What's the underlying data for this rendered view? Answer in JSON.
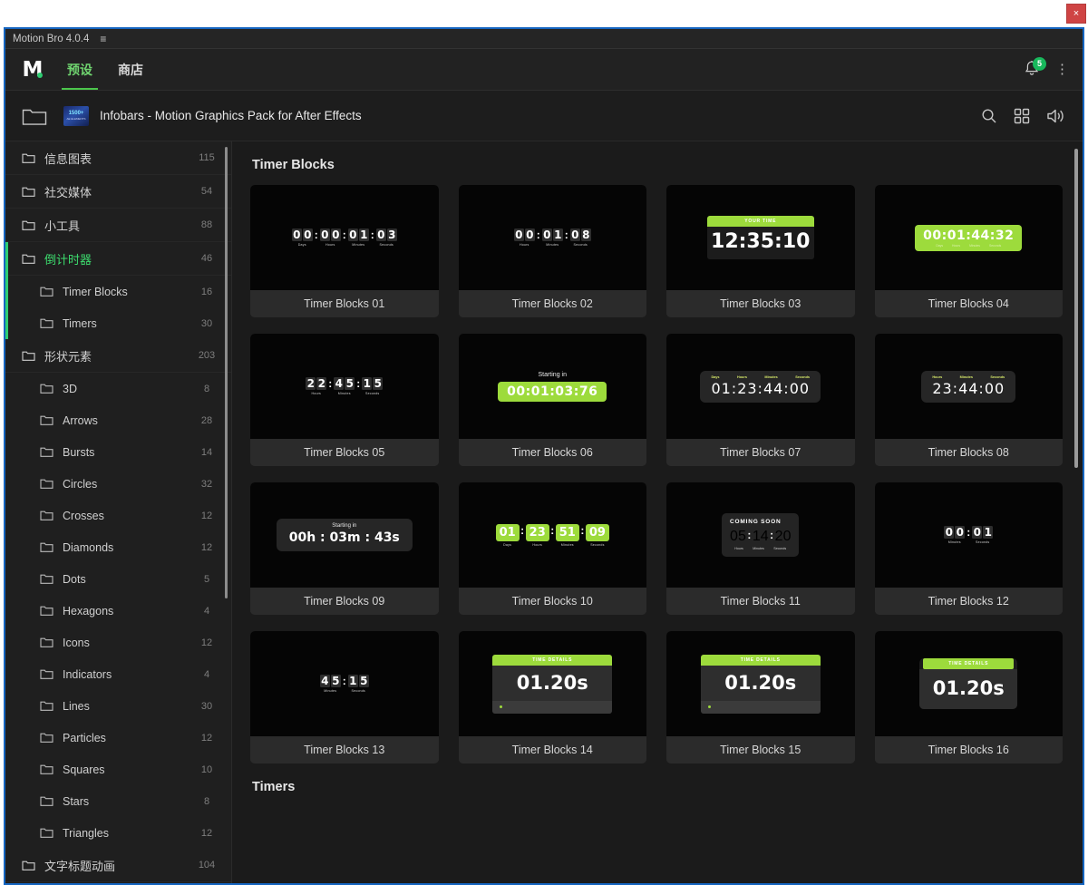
{
  "os": {
    "close_label": "×"
  },
  "panel": {
    "title": "Motion Bro 4.0.4",
    "menu_icon": "≡"
  },
  "nav": {
    "logo_letter": "M",
    "tabs": [
      {
        "label": "预设",
        "active": true
      },
      {
        "label": "商店",
        "active": false
      }
    ],
    "notification_count": "5",
    "kebab_label": "⋮"
  },
  "breadcrumb": {
    "pack_title": "Infobars - Motion Graphics Pack for After Effects",
    "thumb_text_main": "1500+",
    "thumb_text_sub": "AE ELEMENTS",
    "icons": [
      "search-icon",
      "grid-view-icon",
      "sound-icon"
    ]
  },
  "sidebar": {
    "items": [
      {
        "label": "信息图表",
        "count": "115",
        "child": false,
        "active": false
      },
      {
        "label": "社交媒体",
        "count": "54",
        "child": false,
        "active": false
      },
      {
        "label": "小工具",
        "count": "88",
        "child": false,
        "active": false
      },
      {
        "label": "倒计时器",
        "count": "46",
        "child": false,
        "active": true
      },
      {
        "label": "Timer Blocks",
        "count": "16",
        "child": true,
        "active": false
      },
      {
        "label": "Timers",
        "count": "30",
        "child": true,
        "active": false
      },
      {
        "label": "形状元素",
        "count": "203",
        "child": false,
        "active": false
      },
      {
        "label": "3D",
        "count": "8",
        "child": true,
        "active": false
      },
      {
        "label": "Arrows",
        "count": "28",
        "child": true,
        "active": false
      },
      {
        "label": "Bursts",
        "count": "14",
        "child": true,
        "active": false
      },
      {
        "label": "Circles",
        "count": "32",
        "child": true,
        "active": false
      },
      {
        "label": "Crosses",
        "count": "12",
        "child": true,
        "active": false
      },
      {
        "label": "Diamonds",
        "count": "12",
        "child": true,
        "active": false
      },
      {
        "label": "Dots",
        "count": "5",
        "child": true,
        "active": false
      },
      {
        "label": "Hexagons",
        "count": "4",
        "child": true,
        "active": false
      },
      {
        "label": "Icons",
        "count": "12",
        "child": true,
        "active": false
      },
      {
        "label": "Indicators",
        "count": "4",
        "child": true,
        "active": false
      },
      {
        "label": "Lines",
        "count": "30",
        "child": true,
        "active": false
      },
      {
        "label": "Particles",
        "count": "12",
        "child": true,
        "active": false
      },
      {
        "label": "Squares",
        "count": "10",
        "child": true,
        "active": false
      },
      {
        "label": "Stars",
        "count": "8",
        "child": true,
        "active": false
      },
      {
        "label": "Triangles",
        "count": "12",
        "child": true,
        "active": false
      },
      {
        "label": "文字标题动画",
        "count": "104",
        "child": false,
        "active": false
      }
    ]
  },
  "content": {
    "section_title": "Timer Blocks",
    "next_section_title": "Timers",
    "cards": [
      {
        "label": "Timer Blocks 01",
        "style": "flip4",
        "digits": [
          "00",
          "00",
          "01",
          "03"
        ],
        "caps": [
          "Days",
          "Hours",
          "Minutes",
          "Seconds"
        ]
      },
      {
        "label": "Timer Blocks 02",
        "style": "flip3",
        "digits": [
          "00",
          "01",
          "08"
        ],
        "caps": [
          "Hours",
          "Minutes",
          "Seconds"
        ]
      },
      {
        "label": "Timer Blocks 03",
        "style": "yourtime",
        "header": "YOUR TIME",
        "value": "12:35:10"
      },
      {
        "label": "Timer Blocks 04",
        "style": "greenpill",
        "value": "00:01:44:32",
        "caps": [
          "Days",
          "Hours",
          "Minutes",
          "Seconds"
        ]
      },
      {
        "label": "Timer Blocks 05",
        "style": "flip3",
        "digits": [
          "22",
          "45",
          "15"
        ],
        "caps": [
          "Hours",
          "Minutes",
          "Seconds"
        ]
      },
      {
        "label": "Timer Blocks 06",
        "style": "greenpill-titled",
        "header": "Starting in",
        "value": "00:01:03:76"
      },
      {
        "label": "Timer Blocks 07",
        "style": "darkpill",
        "value": "01:23:44:00",
        "caps": [
          "Days",
          "Hours",
          "Minutes",
          "Seconds"
        ]
      },
      {
        "label": "Timer Blocks 08",
        "style": "darkpill",
        "value": "23:44:00",
        "caps": [
          "Hours",
          "Minutes",
          "Seconds"
        ]
      },
      {
        "label": "Timer Blocks 09",
        "style": "darkpill-titled",
        "header": "Starting in",
        "value": "00h : 03m : 43s"
      },
      {
        "label": "Timer Blocks 10",
        "style": "greenblocks",
        "digits": [
          "01",
          "23",
          "51",
          "09"
        ],
        "caps": [
          "Days",
          "Hours",
          "Minutes",
          "Seconds"
        ]
      },
      {
        "label": "Timer Blocks 11",
        "style": "comingsoon",
        "header": "COMING SOON",
        "digits": [
          "0",
          "5",
          "1",
          "4",
          "2",
          "0"
        ],
        "caps": [
          "Hours",
          "Minutes",
          "Seconds"
        ]
      },
      {
        "label": "Timer Blocks 12",
        "style": "flip2",
        "digits": [
          "00",
          "01"
        ],
        "caps": [
          "Minutes",
          "Seconds"
        ]
      },
      {
        "label": "Timer Blocks 13",
        "style": "flip2",
        "digits": [
          "45",
          "15"
        ],
        "caps": [
          "Minutes",
          "Seconds"
        ]
      },
      {
        "label": "Timer Blocks 14",
        "style": "panel-wide",
        "header": "TIME DETAILS",
        "value": "01.20s"
      },
      {
        "label": "Timer Blocks 15",
        "style": "panel-wide",
        "header": "TIME DETAILS",
        "value": "01.20s"
      },
      {
        "label": "Timer Blocks 16",
        "style": "panel-narrow",
        "header": "TIME DETAILS",
        "value": "01.20s"
      }
    ]
  },
  "colors": {
    "accent_green": "#2ecc71",
    "brand_lime": "#9ddb3c",
    "window_border": "#1565c0",
    "close_red": "#cf4444"
  }
}
